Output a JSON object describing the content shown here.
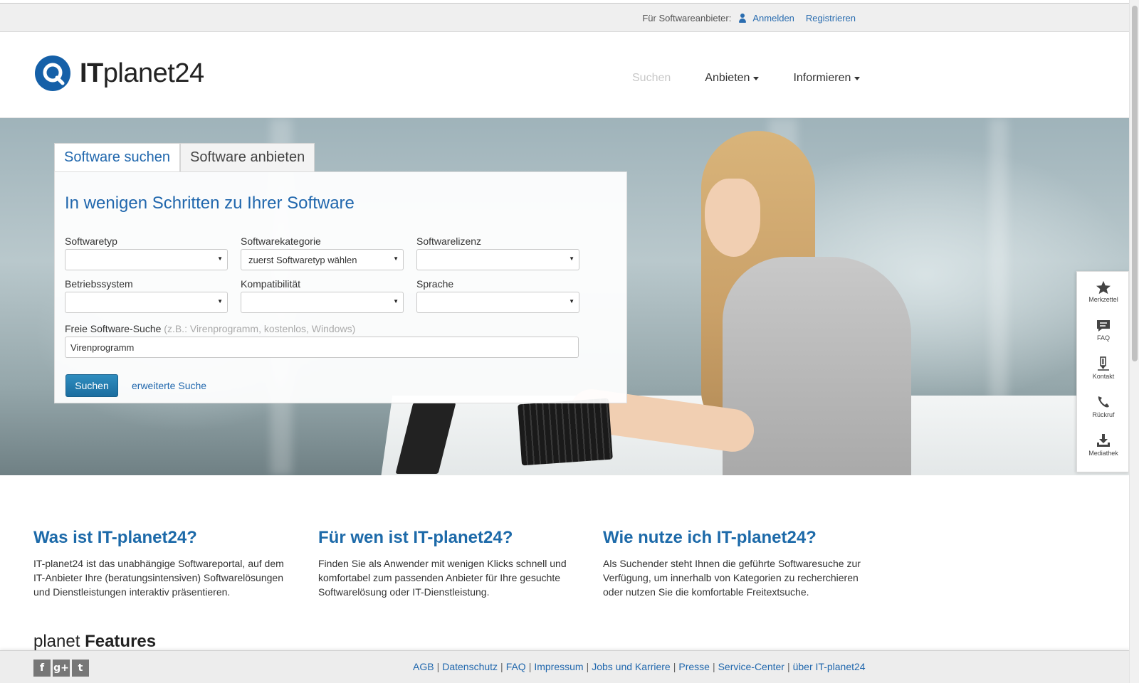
{
  "topbar": {
    "label": "Für Softwareanbieter:",
    "login": "Anmelden",
    "register": "Registrieren"
  },
  "logo": {
    "bold": "IT",
    "rest": "planet24"
  },
  "nav": [
    {
      "label": "Suchen",
      "active": false
    },
    {
      "label": "Anbieten",
      "dropdown": true
    },
    {
      "label": "Informieren",
      "dropdown": true
    }
  ],
  "search": {
    "tabs": [
      "Software suchen",
      "Software anbieten"
    ],
    "title": "In wenigen Schritten zu Ihrer Software",
    "fields": [
      {
        "label": "Softwaretyp",
        "value": ""
      },
      {
        "label": "Softwarekategorie",
        "value": "zuerst Softwaretyp wählen"
      },
      {
        "label": "Softwarelizenz",
        "value": ""
      },
      {
        "label": "Betriebssystem",
        "value": ""
      },
      {
        "label": "Kompatibilität",
        "value": ""
      },
      {
        "label": "Sprache",
        "value": ""
      }
    ],
    "freitext_label": "Freie Software-Suche",
    "freitext_hint": "(z.B.: Virenprogramm, kostenlos, Windows)",
    "freitext_value": "Virenprogramm",
    "button": "Suchen",
    "advanced": "erweiterte Suche"
  },
  "side_tools": [
    {
      "label": "Merkzettel",
      "icon": "star-icon"
    },
    {
      "label": "FAQ",
      "icon": "chat-icon"
    },
    {
      "label": "Kontakt",
      "icon": "pen-icon"
    },
    {
      "label": "Rückruf",
      "icon": "phone-icon"
    },
    {
      "label": "Mediathek",
      "icon": "download-icon"
    }
  ],
  "info": [
    {
      "title": "Was ist IT-planet24?",
      "text": "IT-planet24 ist das unabhängige Softwareportal, auf dem IT-Anbieter Ihre (beratungsintensiven) Softwarelösungen und Dienstleistungen interaktiv präsentieren."
    },
    {
      "title": "Für wen ist IT-planet24?",
      "text": "Finden Sie als Anwender mit wenigen Klicks schnell und komfortabel zum passenden Anbieter für Ihre gesuchte Softwarelösung oder IT-Dienstleistung."
    },
    {
      "title": "Wie nutze ich IT-planet24?",
      "text": "Als Suchender steht Ihnen die geführte Softwaresuche zur Verfügung, um innerhalb von Kategorien zu recherchieren oder nutzen Sie die komfortable Freitextsuche."
    }
  ],
  "features": {
    "light": "planet",
    "bold": "Features"
  },
  "footer": {
    "social": [
      "f",
      "g+",
      "t"
    ],
    "links": [
      "AGB",
      "Datenschutz",
      "FAQ",
      "Impressum",
      "Jobs und Karriere",
      "Presse",
      "Service-Center",
      "über IT-planet24"
    ]
  },
  "colors": {
    "brand": "#1d6aa9",
    "button": "#1b6d9f"
  }
}
